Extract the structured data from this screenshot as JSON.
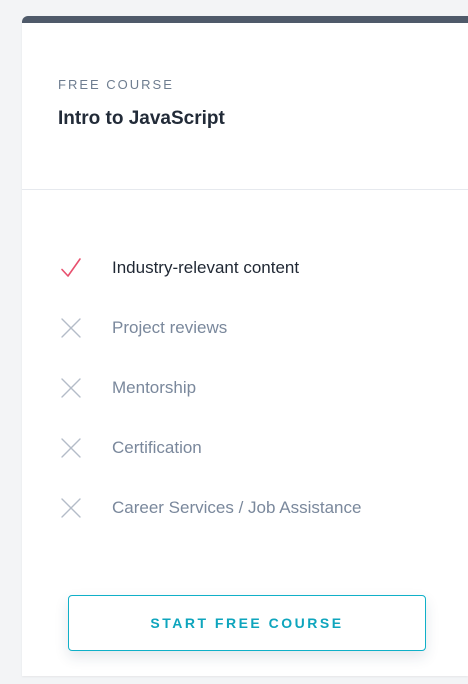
{
  "card": {
    "eyebrow": "FREE COURSE",
    "title": "Intro to JavaScript"
  },
  "features": [
    {
      "label": "Industry-relevant content",
      "included": true,
      "icon": "check-icon"
    },
    {
      "label": "Project reviews",
      "included": false,
      "icon": "x-icon"
    },
    {
      "label": "Mentorship",
      "included": false,
      "icon": "x-icon"
    },
    {
      "label": "Certification",
      "included": false,
      "icon": "x-icon"
    },
    {
      "label": "Career Services / Job Assistance",
      "included": false,
      "icon": "x-icon"
    }
  ],
  "cta": {
    "label": "START FREE COURSE"
  },
  "colors": {
    "accent": "#0ea5bd",
    "check": "#e8506e",
    "cross": "#b4bcc8",
    "header_bar": "#4f5a6a"
  }
}
